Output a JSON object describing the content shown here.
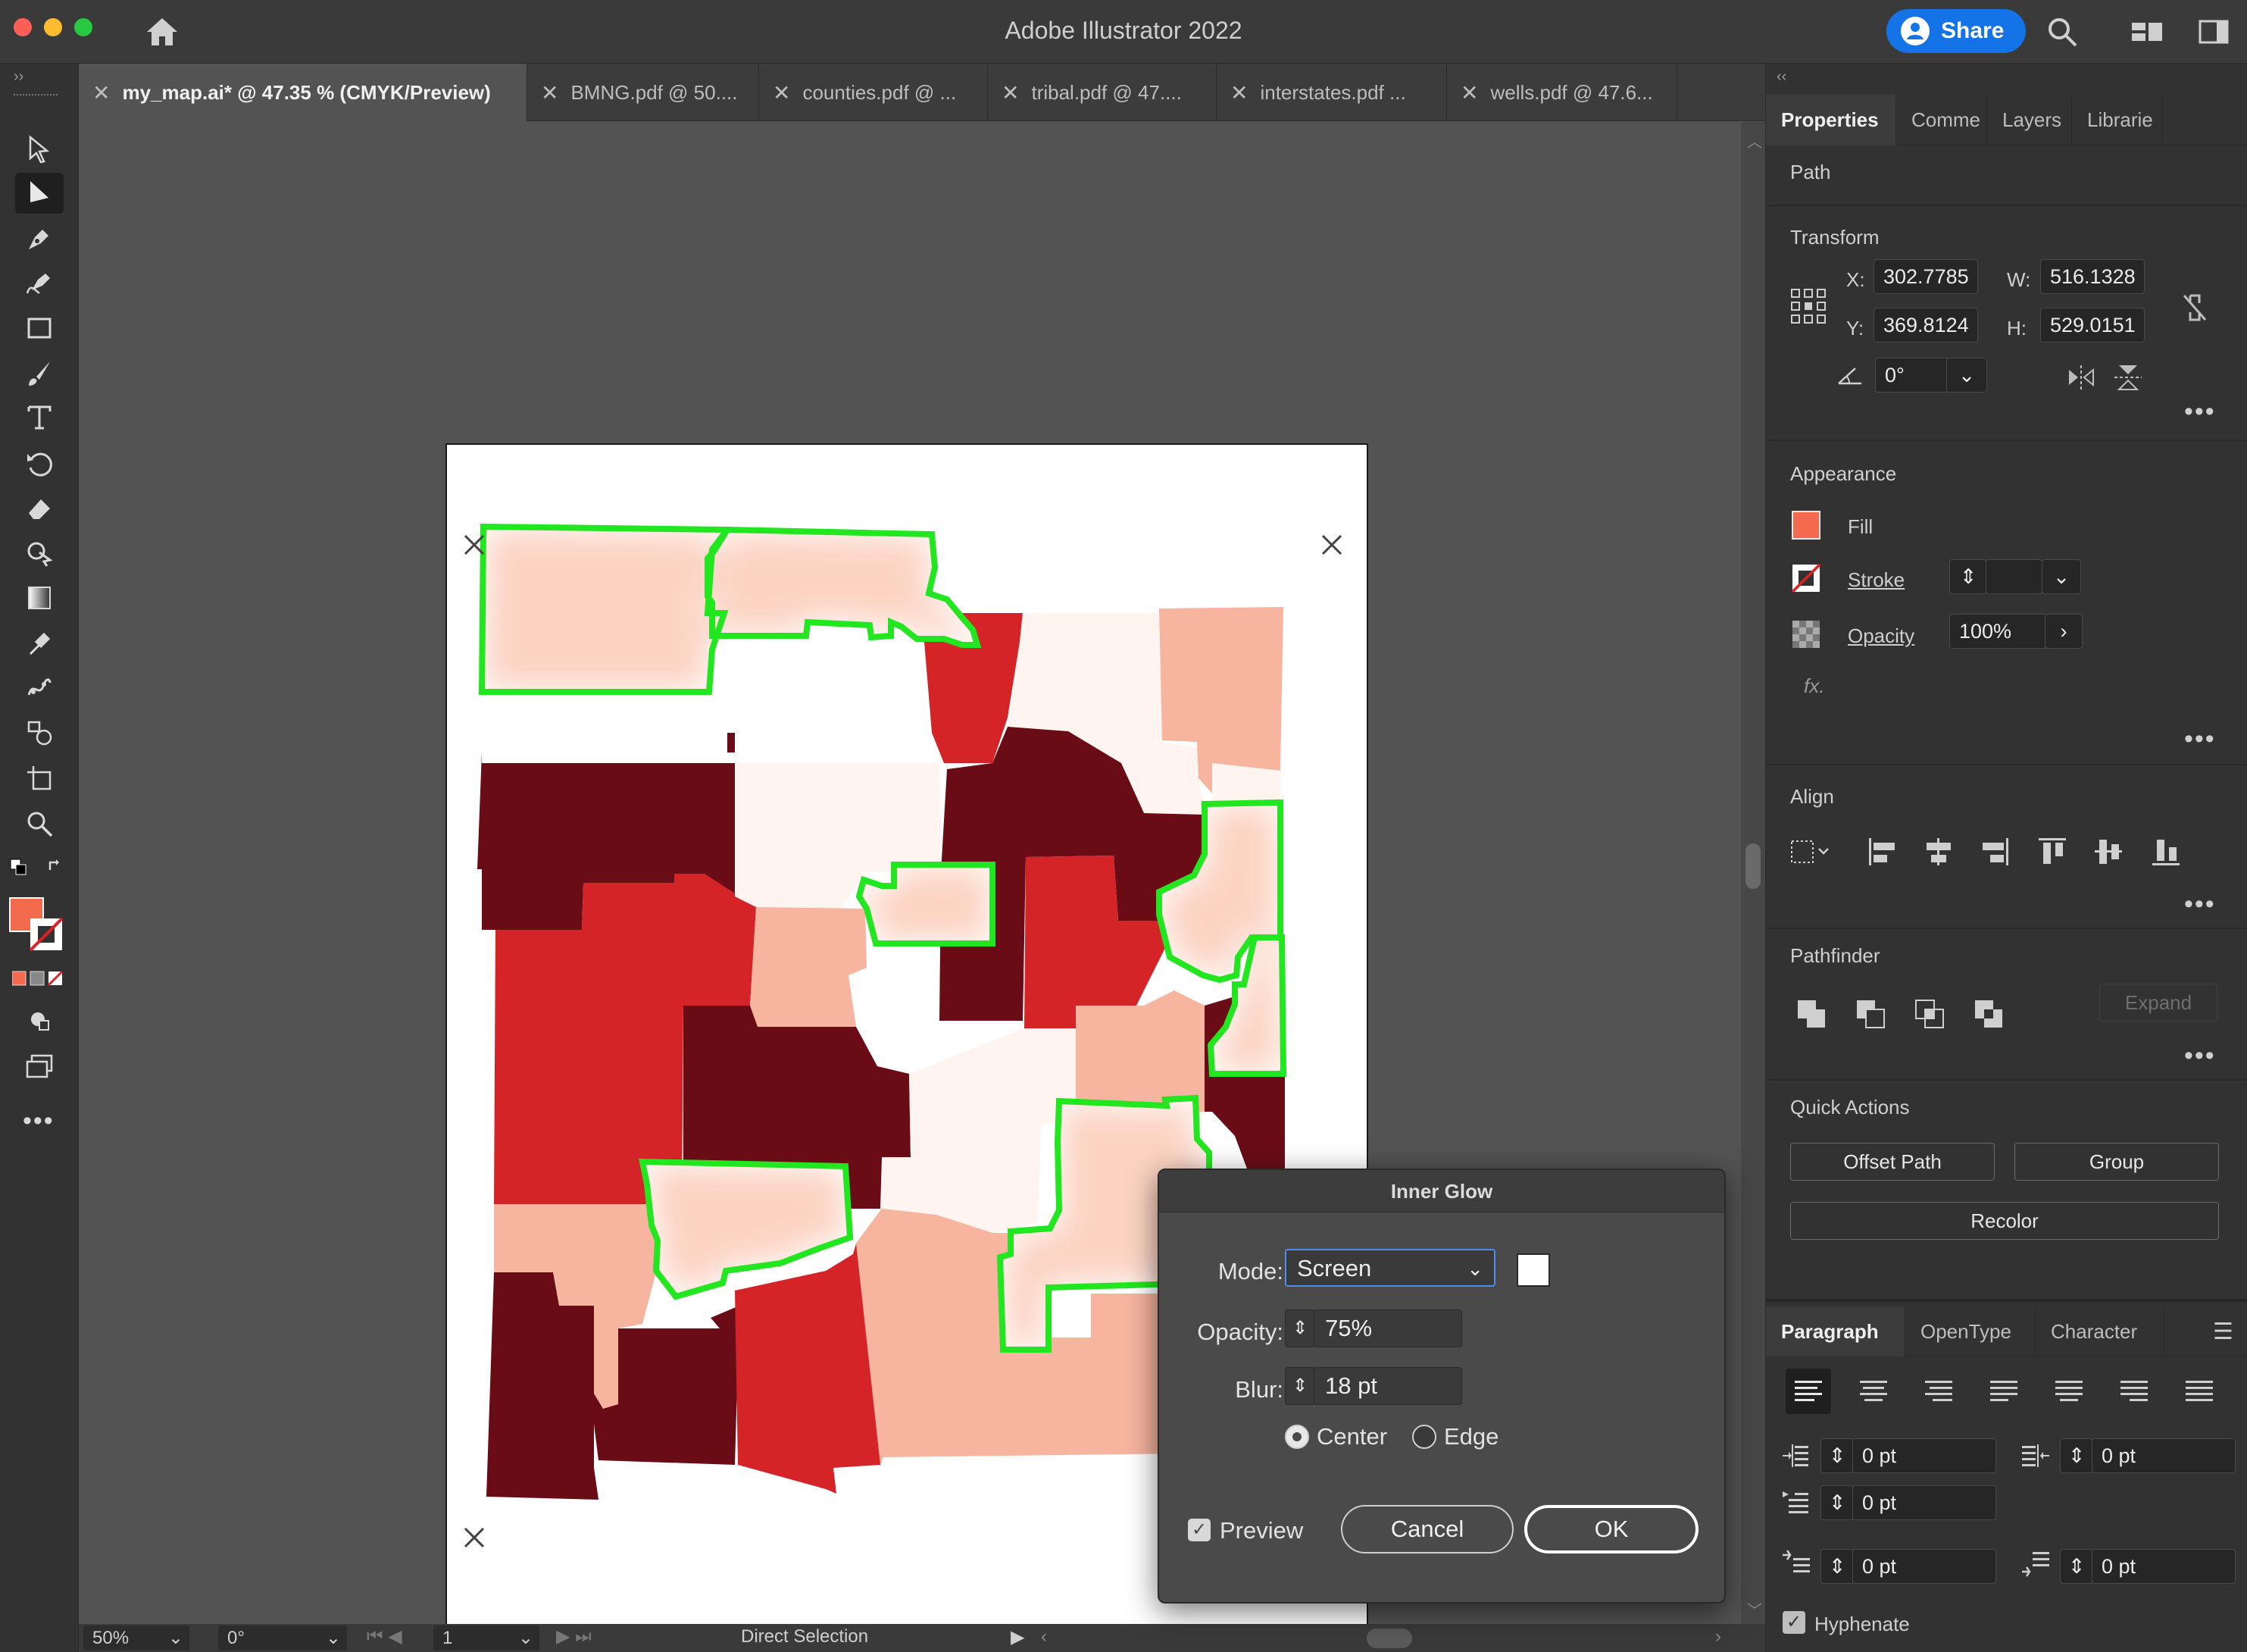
{
  "window": {
    "title": "Adobe Illustrator 2022",
    "share_label": "Share"
  },
  "doc_tabs": [
    {
      "label": "my_map.ai* @ 47.35 % (CMYK/Preview)",
      "active": true
    },
    {
      "label": "BMNG.pdf @ 50...."
    },
    {
      "label": "counties.pdf @ ..."
    },
    {
      "label": "tribal.pdf @ 47...."
    },
    {
      "label": "interstates.pdf ..."
    },
    {
      "label": "wells.pdf @ 47.6..."
    }
  ],
  "tools": [
    "selection-tool",
    "direct-selection-tool",
    "pen-tool",
    "curvature-tool",
    "rectangle-tool",
    "paintbrush-tool",
    "type-tool",
    "rotate-tool",
    "eraser-tool",
    "shape-builder-tool",
    "gradient-tool",
    "eyedropper-tool",
    "puppet-warp-tool",
    "symbol-sprayer-tool",
    "artboard-tool",
    "zoom-tool"
  ],
  "colors": {
    "fill": "#f36a4f",
    "glow": "#ffffff",
    "outline": "#22e61f",
    "c1": "#fff4f0",
    "c2": "#fcd3c2",
    "c3": "#f7b49f",
    "c4": "#d42428",
    "c5": "#690c16"
  },
  "status": {
    "zoom": "50%",
    "angle": "0°",
    "page": "1",
    "tool": "Direct Selection"
  },
  "panel": {
    "tabs": [
      "Properties",
      "Comme",
      "Layers",
      "Librarie"
    ],
    "type_label": "Path",
    "transform": {
      "title": "Transform",
      "x_label": "X:",
      "x": "302.7785",
      "y_label": "Y:",
      "y": "369.8124",
      "w_label": "W:",
      "w": "516.1328",
      "h_label": "H:",
      "h": "529.0151",
      "angle": "0°"
    },
    "appearance": {
      "title": "Appearance",
      "fill_label": "Fill",
      "stroke_label": "Stroke",
      "opacity_label": "Opacity",
      "opacity_value": "100%",
      "fx_label": "fx."
    },
    "align_title": "Align",
    "pathfinder": {
      "title": "Pathfinder",
      "expand_label": "Expand"
    },
    "quick_actions": {
      "title": "Quick Actions",
      "offset_path": "Offset Path",
      "group": "Group",
      "recolor": "Recolor"
    },
    "paragraph": {
      "tabs": [
        "Paragraph",
        "OpenType",
        "Character"
      ],
      "left_indent": "0 pt",
      "right_indent": "0 pt",
      "first_line_indent": "0 pt",
      "space_before": "0 pt",
      "space_after": "0 pt",
      "hyphenate_label": "Hyphenate",
      "hyphenate_checked": true
    }
  },
  "dialog": {
    "title": "Inner Glow",
    "mode_label": "Mode:",
    "mode_value": "Screen",
    "opacity_label": "Opacity:",
    "opacity_value": "75%",
    "blur_label": "Blur:",
    "blur_value": "18 pt",
    "center_label": "Center",
    "edge_label": "Edge",
    "selected_position": "Center",
    "preview_label": "Preview",
    "preview_checked": true,
    "cancel_label": "Cancel",
    "ok_label": "OK"
  }
}
